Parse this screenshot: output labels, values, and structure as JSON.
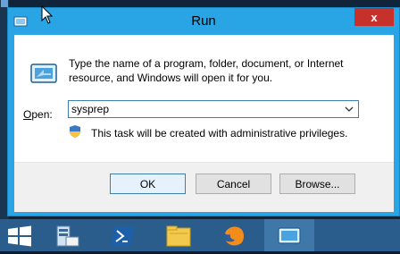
{
  "window": {
    "title": "Run",
    "close_glyph": "x"
  },
  "dialog": {
    "description": "Type the name of a program, folder, document, or Internet resource, and Windows will open it for you.",
    "open_label_prefix": "",
    "open_label_accel": "O",
    "open_label_rest": "pen:",
    "open_value": "sysprep",
    "admin_notice": "This task will be created with administrative privileges."
  },
  "buttons": {
    "ok": "OK",
    "cancel": "Cancel",
    "browse": "Browse..."
  },
  "taskbar": {
    "items": [
      "start-icon",
      "server-manager-icon",
      "powershell-icon",
      "file-explorer-icon",
      "firefox-icon",
      "run-icon"
    ]
  },
  "colors": {
    "frame": "#29a4e4",
    "close": "#c7312c",
    "taskbar": "#2a5d8c"
  }
}
